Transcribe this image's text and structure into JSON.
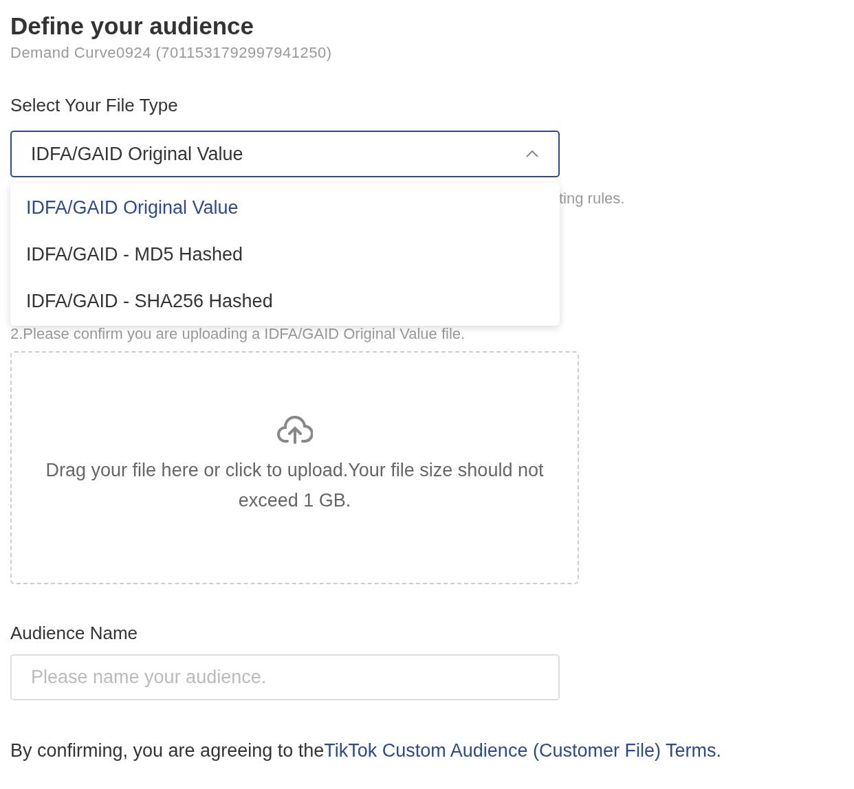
{
  "title": "Define your audience",
  "subtitle": "Demand Curve0924 (7011531792997941250)",
  "file_type": {
    "label": "Select Your File Type",
    "value": "IDFA/GAID Original Value",
    "expanded": true,
    "options": [
      {
        "label": "IDFA/GAID Original Value",
        "selected": true
      },
      {
        "label": "IDFA/GAID - MD5 Hashed",
        "selected": false
      },
      {
        "label": "IDFA/GAID - SHA256 Hashed",
        "selected": false
      }
    ]
  },
  "hints": [
    "ting rules.",
    "2.Please confirm you are uploading a IDFA/GAID Original Value file."
  ],
  "upload": {
    "text": "Drag your file here or click to upload.Your file size should not exceed 1 GB."
  },
  "audience_name": {
    "label": "Audience Name",
    "placeholder": "Please name your audience."
  },
  "terms": {
    "text": "By confirming, you are agreeing to the",
    "link": "TikTok Custom Audience (Customer File) Terms."
  }
}
